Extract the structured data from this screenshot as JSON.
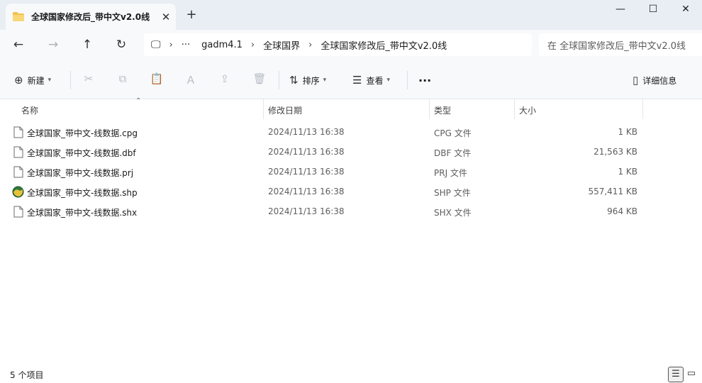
{
  "tab": {
    "title": "全球国家修改后_带中文v2.0线",
    "close": "✕"
  },
  "newtab": "+",
  "window": {
    "minimize": "—",
    "maximize": "☐",
    "close": "✕"
  },
  "nav": {
    "back": "←",
    "forward": "→",
    "up": "↑",
    "refresh": "↻"
  },
  "address": {
    "monitor_icon": "🖵",
    "more": "···",
    "chevron": "›",
    "segments": [
      "gadm4.1",
      "全球国界",
      "全球国家修改后_带中文v2.0线"
    ]
  },
  "search": {
    "placeholder": "在 全球国家修改后_带中文v2.0线"
  },
  "toolbar": {
    "new_label": "新建",
    "sort_label": "排序",
    "view_label": "查看",
    "more_label": "···",
    "details_label": "详细信息"
  },
  "columns": {
    "name": "名称",
    "date": "修改日期",
    "type": "类型",
    "size": "大小"
  },
  "files": [
    {
      "name": "全球国家_带中文-线数据.cpg",
      "date": "2024/11/13 16:38",
      "type": "CPG 文件",
      "size": "1 KB",
      "icon": "document-icon"
    },
    {
      "name": "全球国家_带中文-线数据.dbf",
      "date": "2024/11/13 16:38",
      "type": "DBF 文件",
      "size": "21,563 KB",
      "icon": "document-icon"
    },
    {
      "name": "全球国家_带中文-线数据.prj",
      "date": "2024/11/13 16:38",
      "type": "PRJ 文件",
      "size": "1 KB",
      "icon": "document-icon"
    },
    {
      "name": "全球国家_带中文-线数据.shp",
      "date": "2024/11/13 16:38",
      "type": "SHP 文件",
      "size": "557,411 KB",
      "icon": "globe-icon"
    },
    {
      "name": "全球国家_带中文-线数据.shx",
      "date": "2024/11/13 16:38",
      "type": "SHX 文件",
      "size": "964 KB",
      "icon": "document-icon"
    }
  ],
  "status": {
    "count": "5 个项目"
  },
  "colors": {
    "folder": "#f2c14e",
    "accent": "#0067c0",
    "background": "#eef2f6"
  }
}
